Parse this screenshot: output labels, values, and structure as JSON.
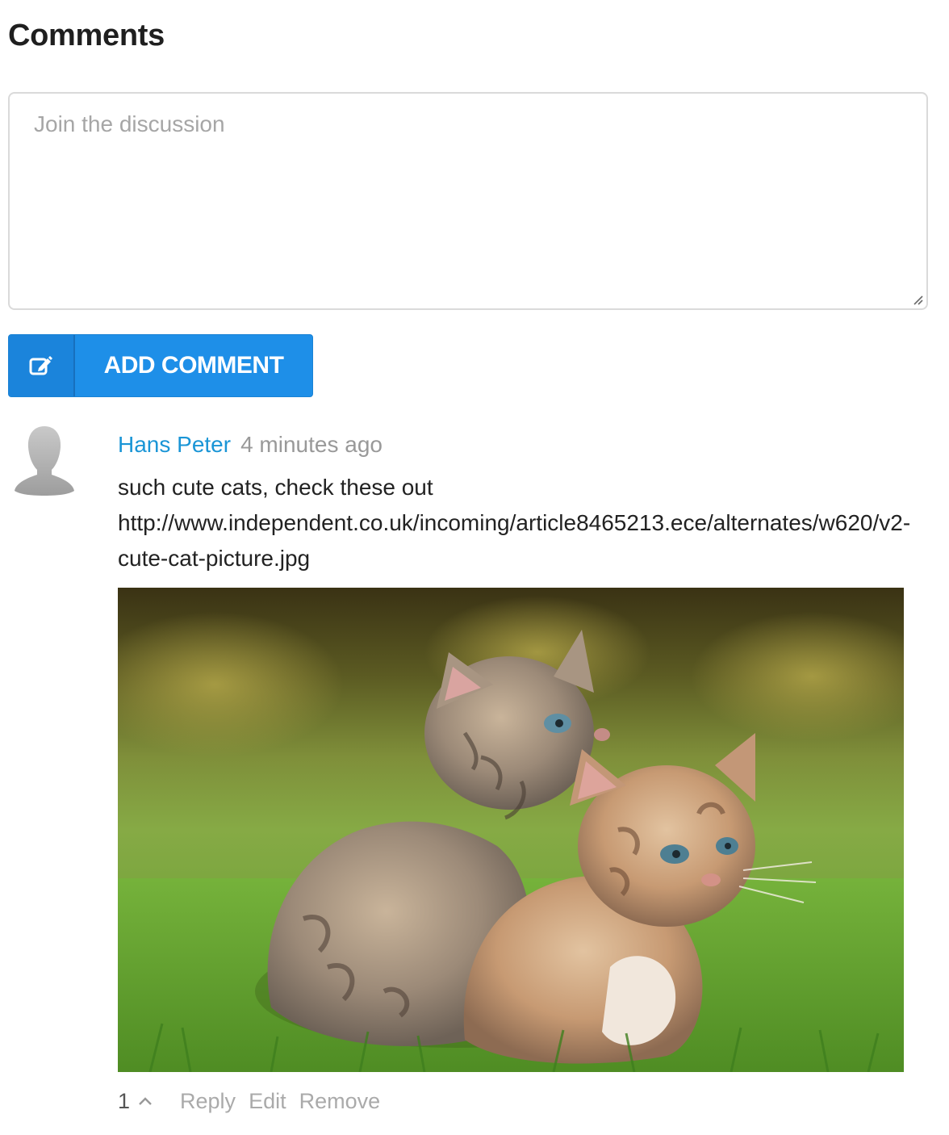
{
  "section": {
    "title": "Comments"
  },
  "composer": {
    "placeholder": "Join the discussion",
    "value": ""
  },
  "add_button": {
    "label": "ADD COMMENT",
    "icon": "edit-icon"
  },
  "comment": {
    "author": "Hans Peter",
    "time": "4 minutes ago",
    "text_line1": "such cute cats, check these out",
    "text_link": "http://www.independent.co.uk/incoming/article8465213.ece/alternates/w620/v2-cute-cat-picture.jpg",
    "image_alt": "two tabby kittens on grass",
    "votes": "1",
    "actions": {
      "reply": "Reply",
      "edit": "Edit",
      "remove": "Remove"
    }
  },
  "colors": {
    "accent": "#1e8fe8",
    "author_link": "#1a95d6",
    "muted": "#aaaaaa"
  }
}
